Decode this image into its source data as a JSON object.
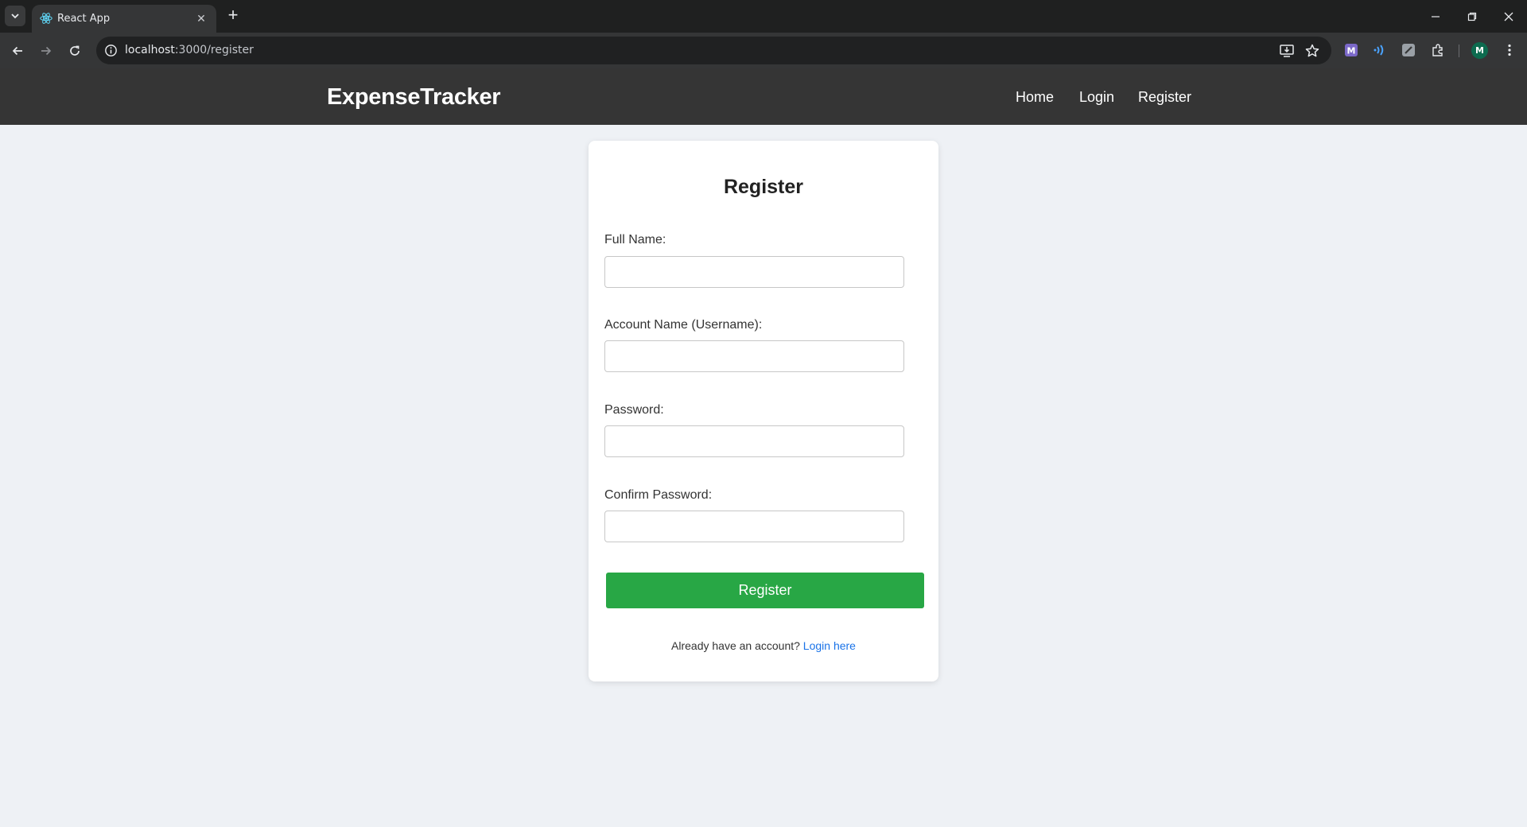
{
  "browser": {
    "tab_title": "React App",
    "url_host": "localhost",
    "url_path": ":3000/register",
    "profile_initial": "M",
    "icons": [
      "tab-search-icon",
      "react-favicon-icon",
      "close-icon",
      "plus-icon",
      "minimize-icon",
      "restore-icon",
      "close-window-icon",
      "back-arrow-icon",
      "forward-arrow-icon",
      "reload-icon",
      "site-info-icon",
      "install-app-icon",
      "bookmark-star-icon",
      "extension-m-icon",
      "extension-wave-icon",
      "extension-pen-icon",
      "puzzle-icon",
      "kebab-menu-icon"
    ]
  },
  "nav": {
    "brand": "ExpenseTracker",
    "links": [
      "Home",
      "Login",
      "Register"
    ]
  },
  "form": {
    "title": "Register",
    "fields": [
      {
        "label": "Full Name:",
        "value": ""
      },
      {
        "label": "Account Name (Username):",
        "value": ""
      },
      {
        "label": "Password:",
        "value": ""
      },
      {
        "label": "Confirm Password:",
        "value": ""
      }
    ],
    "submit_label": "Register",
    "footer_prompt": "Already have an account?",
    "footer_link": "Login here"
  },
  "colors": {
    "nav_bg": "#353535",
    "page_bg": "#eef1f5",
    "button_green": "#28a745",
    "link_blue": "#1a73e8"
  }
}
